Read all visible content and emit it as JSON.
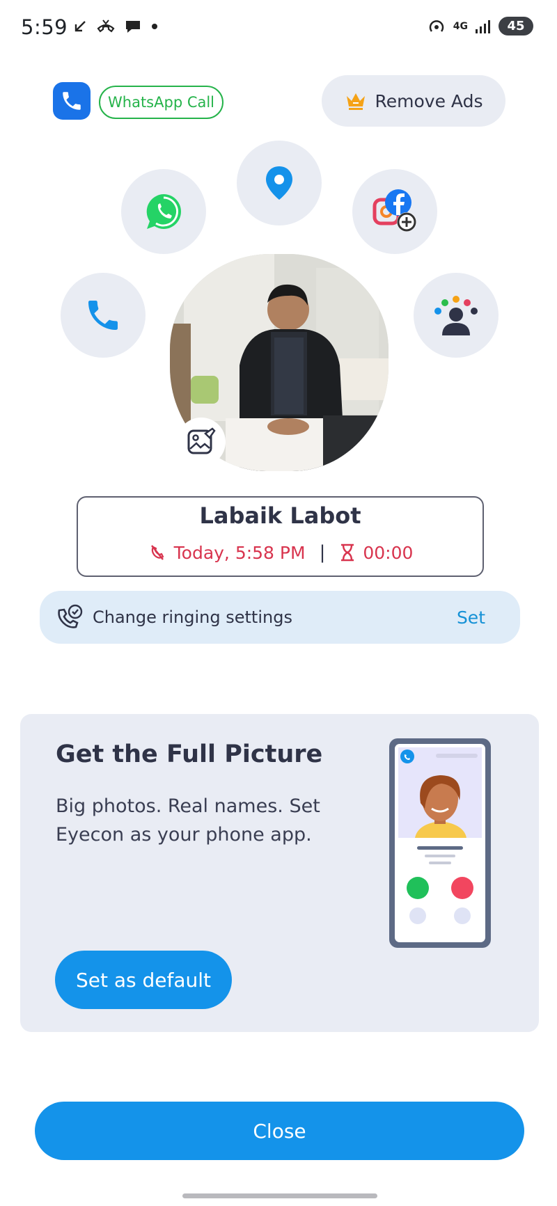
{
  "status_bar": {
    "time": "5:59",
    "network": "4G",
    "battery": "45"
  },
  "top": {
    "whatsapp_call_label": "WhatsApp Call",
    "remove_ads_label": "Remove Ads"
  },
  "actions": {
    "icons": [
      "whatsapp-icon",
      "location-icon",
      "social-add-icon",
      "phone-icon",
      "contacts-group-icon"
    ]
  },
  "contact": {
    "name": "Labaik Labot",
    "call_time": "Today, 5:58 PM",
    "separator": "|",
    "duration": "00:00"
  },
  "ringing": {
    "label": "Change ringing settings",
    "action": "Set"
  },
  "promo": {
    "title": "Get the Full Picture",
    "body": "Big photos. Real names. Set Eyecon as your phone app.",
    "button": "Set as default"
  },
  "footer": {
    "close": "Close"
  },
  "colors": {
    "accent": "#1493ea",
    "whatsapp": "#25b34a",
    "missed": "#d8344e",
    "chip_bg": "#e9ecf3"
  }
}
